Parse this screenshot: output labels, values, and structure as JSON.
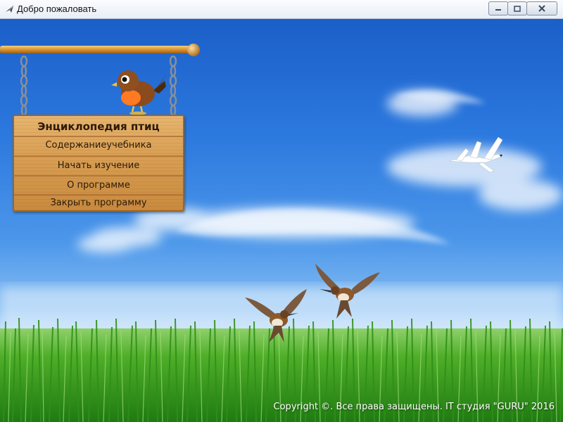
{
  "window": {
    "title": "Добро пожаловать"
  },
  "sign": {
    "title": "Энциклопедия птиц",
    "menu": [
      {
        "label": "Содержаниеучебника"
      },
      {
        "label": "Начать изучение"
      },
      {
        "label": "О программе"
      },
      {
        "label": "Закрыть программу"
      }
    ]
  },
  "footer": {
    "copyright": "Copyright ©. Все права защищены. IT студия \"GURU\" 2016"
  },
  "icons": [
    "app-icon",
    "minimize-icon",
    "maximize-icon",
    "close-icon"
  ],
  "colors": {
    "sky_top": "#1b5fc8",
    "grass": "#3a9b1e",
    "sign_wood": "#d9a055"
  }
}
